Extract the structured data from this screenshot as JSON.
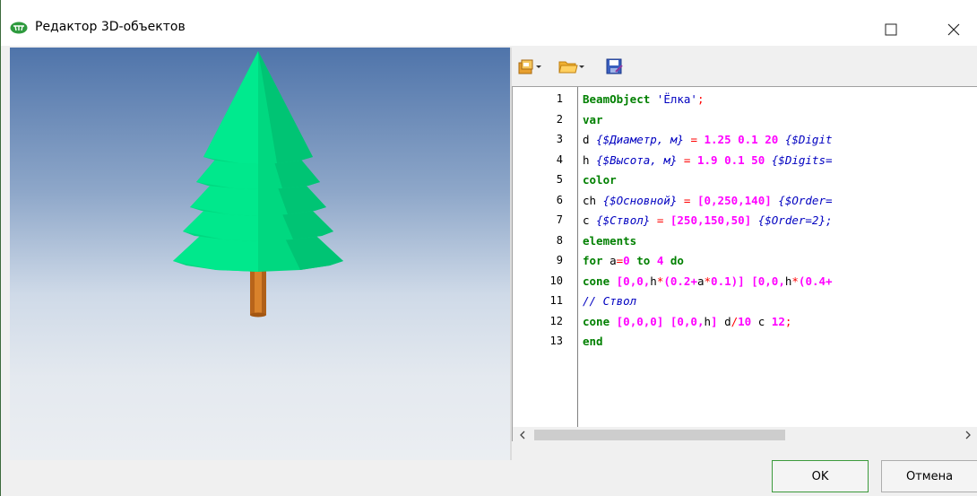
{
  "window": {
    "title": "Редактор 3D-объектов",
    "maximize_icon": "maximize-icon",
    "close_icon": "close-icon"
  },
  "viewport": {
    "tree_color": "#00e88c",
    "trunk_color": "#d9822b"
  },
  "toolbar": {
    "icons": [
      "templates-icon",
      "dropdown-arrow-icon",
      "open-folder-icon",
      "dropdown-arrow-icon",
      "save-icon"
    ]
  },
  "code": {
    "line_numbers": [
      "1",
      "2",
      "3",
      "4",
      "5",
      "6",
      "7",
      "8",
      "9",
      "10",
      "11",
      "12",
      "13"
    ],
    "lines": [
      [
        {
          "t": "kw",
          "v": "BeamObject"
        },
        {
          "t": "id",
          "v": " "
        },
        {
          "t": "str",
          "v": "'Ёлка'"
        },
        {
          "t": "op",
          "v": ";"
        }
      ],
      [
        {
          "t": "kw",
          "v": "var"
        }
      ],
      [
        {
          "t": "id",
          "v": "d "
        },
        {
          "t": "cm",
          "v": "{$Диаметр, м}"
        },
        {
          "t": "id",
          "v": " "
        },
        {
          "t": "op",
          "v": "="
        },
        {
          "t": "id",
          "v": " "
        },
        {
          "t": "num",
          "v": "1.25 0.1 20"
        },
        {
          "t": "id",
          "v": " "
        },
        {
          "t": "cm",
          "v": "{$Digit"
        }
      ],
      [
        {
          "t": "id",
          "v": "h "
        },
        {
          "t": "cm",
          "v": "{$Высота, м}"
        },
        {
          "t": "id",
          "v": " "
        },
        {
          "t": "op",
          "v": "="
        },
        {
          "t": "id",
          "v": " "
        },
        {
          "t": "num",
          "v": "1.9 0.1 50"
        },
        {
          "t": "id",
          "v": " "
        },
        {
          "t": "cm",
          "v": "{$Digits="
        }
      ],
      [
        {
          "t": "kw",
          "v": "color"
        }
      ],
      [
        {
          "t": "id",
          "v": "ch "
        },
        {
          "t": "cm",
          "v": "{$Основной}"
        },
        {
          "t": "id",
          "v": " "
        },
        {
          "t": "op",
          "v": "="
        },
        {
          "t": "id",
          "v": " "
        },
        {
          "t": "num",
          "v": "[0,250,140]"
        },
        {
          "t": "id",
          "v": " "
        },
        {
          "t": "cm",
          "v": "{$Order="
        }
      ],
      [
        {
          "t": "id",
          "v": "c "
        },
        {
          "t": "cm",
          "v": "{$Ствол}"
        },
        {
          "t": "id",
          "v": " "
        },
        {
          "t": "op",
          "v": "="
        },
        {
          "t": "id",
          "v": " "
        },
        {
          "t": "num",
          "v": "[250,150,50]"
        },
        {
          "t": "id",
          "v": " "
        },
        {
          "t": "cm",
          "v": "{$Order=2};"
        }
      ],
      [
        {
          "t": "kw",
          "v": "elements"
        }
      ],
      [
        {
          "t": "kw",
          "v": "for"
        },
        {
          "t": "id",
          "v": " a"
        },
        {
          "t": "op",
          "v": "="
        },
        {
          "t": "num",
          "v": "0"
        },
        {
          "t": "id",
          "v": " "
        },
        {
          "t": "kw",
          "v": "to"
        },
        {
          "t": "id",
          "v": " "
        },
        {
          "t": "num",
          "v": "4"
        },
        {
          "t": "id",
          "v": " "
        },
        {
          "t": "kw",
          "v": "do"
        }
      ],
      [
        {
          "t": "kw",
          "v": "cone"
        },
        {
          "t": "id",
          "v": " "
        },
        {
          "t": "num",
          "v": "[0,0,"
        },
        {
          "t": "id",
          "v": "h"
        },
        {
          "t": "op",
          "v": "*"
        },
        {
          "t": "num",
          "v": "(0.2+"
        },
        {
          "t": "id",
          "v": "a"
        },
        {
          "t": "op",
          "v": "*"
        },
        {
          "t": "num",
          "v": "0.1)]"
        },
        {
          "t": "id",
          "v": " "
        },
        {
          "t": "num",
          "v": "[0,0,"
        },
        {
          "t": "id",
          "v": "h"
        },
        {
          "t": "op",
          "v": "*"
        },
        {
          "t": "num",
          "v": "(0.4+"
        }
      ],
      [
        {
          "t": "cm",
          "v": "// Ствол"
        }
      ],
      [
        {
          "t": "kw",
          "v": "cone"
        },
        {
          "t": "id",
          "v": " "
        },
        {
          "t": "num",
          "v": "[0,0,0]"
        },
        {
          "t": "id",
          "v": " "
        },
        {
          "t": "num",
          "v": "[0,0,"
        },
        {
          "t": "id",
          "v": "h"
        },
        {
          "t": "num",
          "v": "]"
        },
        {
          "t": "id",
          "v": " d"
        },
        {
          "t": "op",
          "v": "/"
        },
        {
          "t": "num",
          "v": "10"
        },
        {
          "t": "id",
          "v": " c "
        },
        {
          "t": "num",
          "v": "12"
        },
        {
          "t": "op",
          "v": ";"
        }
      ],
      [
        {
          "t": "kw",
          "v": "end"
        }
      ]
    ]
  },
  "scrollbar": {
    "left_icon": "scroll-left-icon",
    "right_icon": "scroll-right-icon"
  },
  "buttons": {
    "ok_label": "OK",
    "cancel_label": "Отмена"
  }
}
